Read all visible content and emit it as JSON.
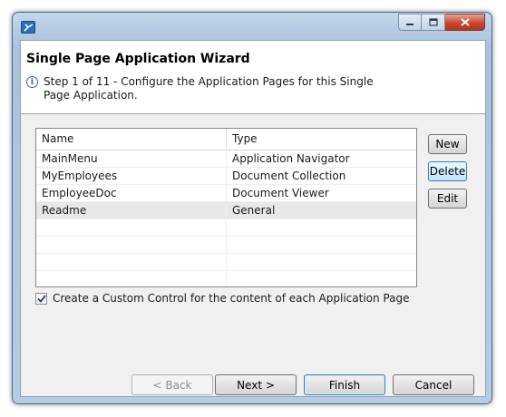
{
  "window": {
    "title": "Single Page Application Wizard",
    "description": "Step 1 of 11 - Configure the Application Pages for this Single Page Application.",
    "info_icon_glyph": "i"
  },
  "table": {
    "columns": [
      "Name",
      "Type"
    ],
    "rows": [
      {
        "name": "MainMenu",
        "type": "Application Navigator",
        "selected": false
      },
      {
        "name": "MyEmployees",
        "type": "Document Collection",
        "selected": false
      },
      {
        "name": "EmployeeDoc",
        "type": "Document Viewer",
        "selected": false
      },
      {
        "name": "Readme",
        "type": "General",
        "selected": true
      }
    ]
  },
  "side_buttons": {
    "new_label": "New",
    "delete_label": "Delete",
    "edit_label": "Edit"
  },
  "options": {
    "custom_control_label": "Create a Custom Control for the content of each Application Page",
    "custom_control_checked": true
  },
  "footer": {
    "back_label": "< Back",
    "next_label": "Next >",
    "finish_label": "Finish",
    "cancel_label": "Cancel"
  },
  "colors": {
    "accent": "#3c7fb1",
    "selection": "#e8e8e8"
  }
}
